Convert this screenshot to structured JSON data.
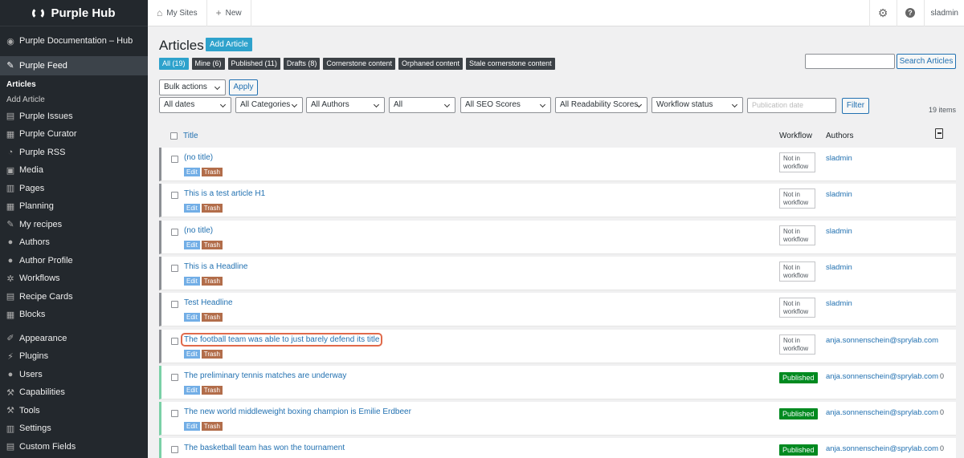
{
  "brand": {
    "name": "Purple Hub"
  },
  "sidebar": {
    "items": [
      {
        "label": "Purple Documentation – Hub",
        "icon": "dashboard-icon"
      },
      {
        "label": "Purple Feed",
        "icon": "pin-icon"
      },
      {
        "label": "Purple Issues",
        "icon": "issues-icon"
      },
      {
        "label": "Purple Curator",
        "icon": "curator-icon"
      },
      {
        "label": "Purple RSS",
        "icon": "rss-icon"
      },
      {
        "label": "Media",
        "icon": "media-icon"
      },
      {
        "label": "Pages",
        "icon": "pages-icon"
      },
      {
        "label": "Planning",
        "icon": "calendar-icon"
      },
      {
        "label": "My recipes",
        "icon": "pin-icon"
      },
      {
        "label": "Authors",
        "icon": "users-icon"
      },
      {
        "label": "Author Profile",
        "icon": "user-icon"
      },
      {
        "label": "Workflows",
        "icon": "gear-icon"
      },
      {
        "label": "Recipe Cards",
        "icon": "cards-icon"
      },
      {
        "label": "Blocks",
        "icon": "blocks-icon"
      },
      {
        "label": "Appearance",
        "icon": "brush-icon"
      },
      {
        "label": "Plugins",
        "icon": "plugin-icon"
      },
      {
        "label": "Users",
        "icon": "users-icon"
      },
      {
        "label": "Capabilities",
        "icon": "wrench-icon"
      },
      {
        "label": "Tools",
        "icon": "wrench-icon"
      },
      {
        "label": "Settings",
        "icon": "settings-icon"
      },
      {
        "label": "Custom Fields",
        "icon": "fields-icon"
      }
    ],
    "sub": {
      "articles": "Articles",
      "add_article": "Add Article"
    }
  },
  "topbar": {
    "my_sites": "My Sites",
    "new": "New",
    "user": "sladmin"
  },
  "page": {
    "title": "Articles",
    "add_button": "Add Article",
    "statuses": [
      "All (19)",
      "Mine (6)",
      "Published (11)",
      "Drafts (8)",
      "Cornerstone content",
      "Orphaned content",
      "Stale cornerstone content"
    ],
    "search_button": "Search Articles",
    "bulk_actions": "Bulk actions",
    "apply": "Apply",
    "filters": [
      "All dates",
      "All Categories",
      "All Authors",
      "All",
      "All SEO Scores",
      "All Readability Scores",
      "Workflow status"
    ],
    "pubdate_placeholder": "Publication date",
    "filter_button": "Filter",
    "items_count": "19 items"
  },
  "table": {
    "headers": {
      "title": "Title",
      "workflow": "Workflow",
      "authors": "Authors"
    },
    "actions": {
      "edit": "Edit",
      "trash": "Trash"
    },
    "rows": [
      {
        "title": "(no title)",
        "workflow": "Not in workflow",
        "author": "sladmin",
        "count": ""
      },
      {
        "title": "This is a test article H1",
        "workflow": "Not in workflow",
        "author": "sladmin",
        "count": ""
      },
      {
        "title": "(no title)",
        "workflow": "Not in workflow",
        "author": "sladmin",
        "count": ""
      },
      {
        "title": "This is a Headline",
        "workflow": "Not in workflow",
        "author": "sladmin",
        "count": ""
      },
      {
        "title": "Test Headline",
        "workflow": "Not in workflow",
        "author": "sladmin",
        "count": ""
      },
      {
        "title": "The football team was able to just barely defend its title",
        "workflow": "Not in workflow",
        "author": "anja.sonnenschein@sprylab.com",
        "count": ""
      },
      {
        "title": "The preliminary tennis matches are underway",
        "workflow": "Published",
        "author": "anja.sonnenschein@sprylab.com",
        "count": "0"
      },
      {
        "title": "The new world middleweight boxing champion is Emilie Erdbeer",
        "workflow": "Published",
        "author": "anja.sonnenschein@sprylab.com",
        "count": "0"
      },
      {
        "title": "The basketball team has won the tournament",
        "workflow": "Published",
        "author": "anja.sonnenschein@sprylab.com",
        "count": "0"
      }
    ]
  }
}
